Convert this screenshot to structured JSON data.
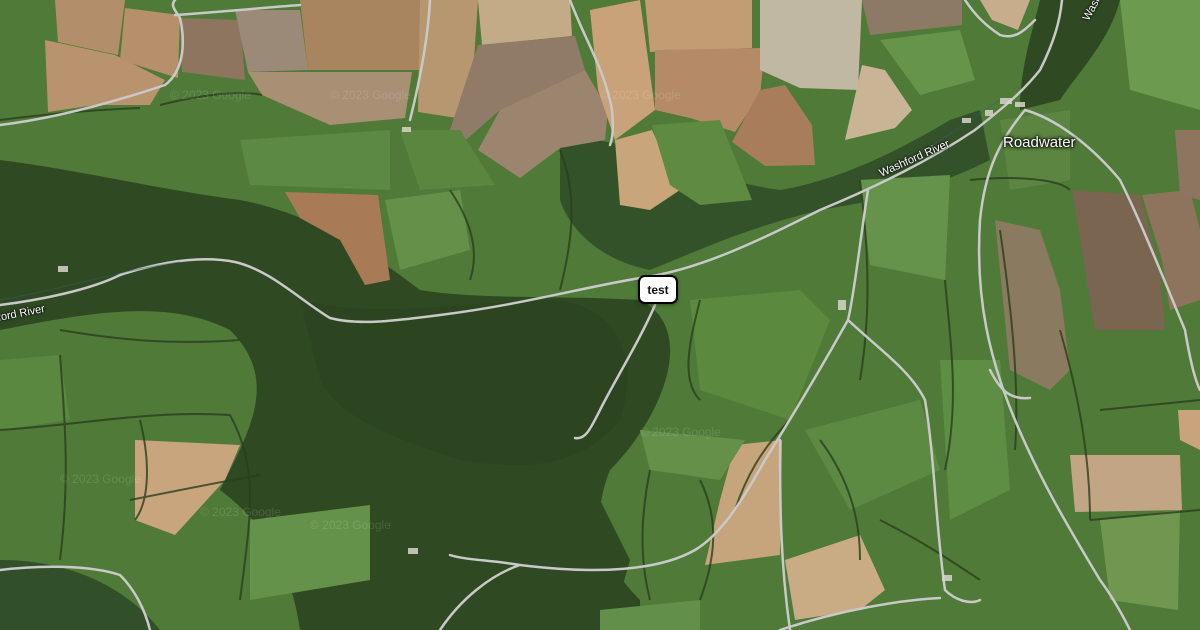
{
  "map": {
    "view": "satellite",
    "colors": {
      "forest": "#2f4a22",
      "pasture": "#4f7a37",
      "pasture_light": "#64904a",
      "field_tan": "#b28e6a",
      "field_brown": "#8e7560",
      "road": "#c9c9c9"
    },
    "places": [
      {
        "label": "Roadwater"
      }
    ],
    "rivers": [
      {
        "label": "Washford River"
      },
      {
        "label": "ford River"
      },
      {
        "label": "Wash"
      }
    ],
    "watermark": "© 2023 Google",
    "marker": {
      "label": "test",
      "icon": "map-pin-label-icon"
    }
  }
}
